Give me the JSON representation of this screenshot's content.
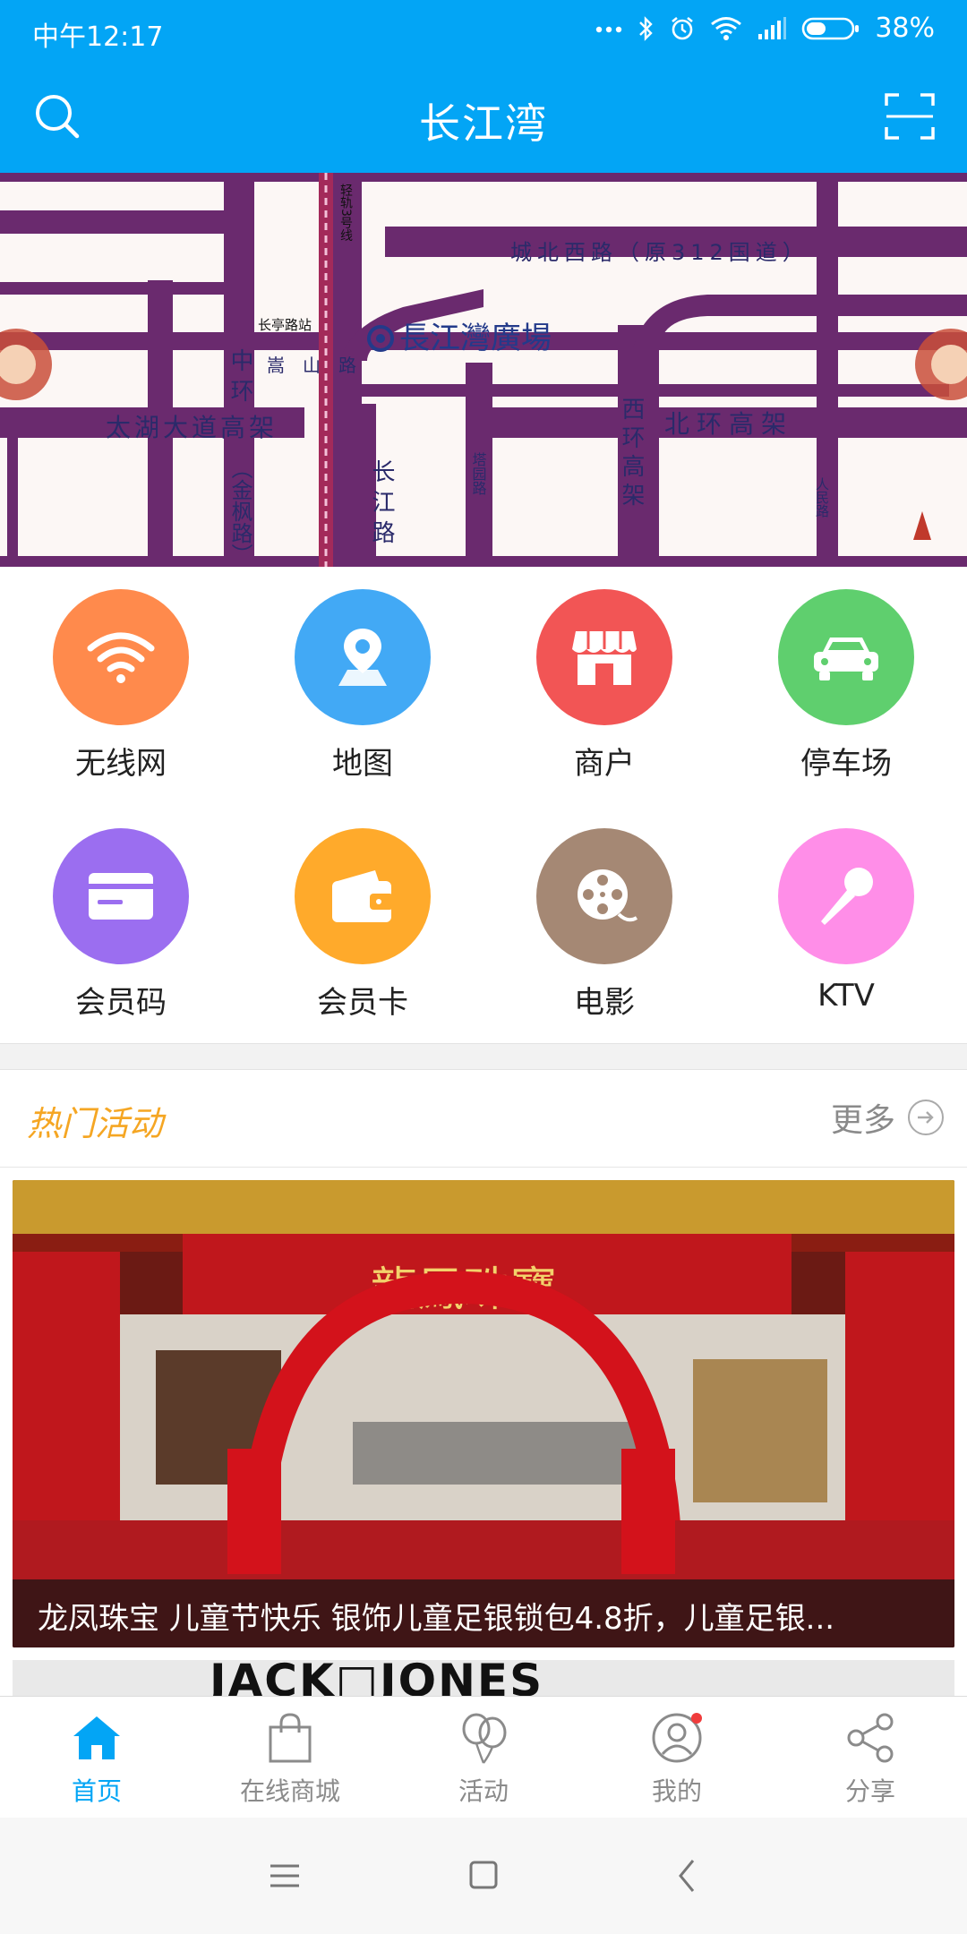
{
  "status_bar": {
    "time": "中午12:17",
    "battery": "38%",
    "icons": [
      "more-dots-icon",
      "bluetooth-icon",
      "alarm-icon",
      "wifi-icon",
      "signal-icon",
      "battery-icon"
    ]
  },
  "header": {
    "title": "长江湾",
    "left_icon": "search-icon",
    "right_icon": "scan-icon",
    "background": "#03a5f5"
  },
  "banner": {
    "type": "map",
    "labels": {
      "logo": "長江灣廣場",
      "road_north": "城北西路（原312国道）",
      "road_taihu": "太湖大道高架",
      "road_beihuan": "北环高架",
      "road_songshan": "嵩山路",
      "road_zhonghuan": "中环",
      "road_jinfeng": "（金枫路）",
      "road_changjiang": "长江路",
      "road_tayuan": "塔园路",
      "road_xihuan": "西环高架",
      "road_renmin": "人民路",
      "rail_line": "轻轨3号线",
      "station": "长亭路站"
    }
  },
  "quick_grid": [
    {
      "label": "无线网",
      "icon": "wifi-icon",
      "color": "#ff8a4c"
    },
    {
      "label": "地图",
      "icon": "map-pin-icon",
      "color": "#42a9f5"
    },
    {
      "label": "商户",
      "icon": "store-icon",
      "color": "#f25555"
    },
    {
      "label": "停车场",
      "icon": "car-icon",
      "color": "#5fcf6e"
    },
    {
      "label": "会员码",
      "icon": "member-code-icon",
      "color": "#9b6ef0"
    },
    {
      "label": "会员卡",
      "icon": "wallet-icon",
      "color": "#ffaa2b"
    },
    {
      "label": "电影",
      "icon": "film-reel-icon",
      "color": "#a58874"
    },
    {
      "label": "KTV",
      "icon": "microphone-icon",
      "color": "#ff8ee8"
    }
  ],
  "hot_activities": {
    "title": "热门活动",
    "more_label": "更多",
    "items": [
      {
        "caption": "龙凤珠宝 儿童节快乐 银饰儿童足银锁包4.8折，儿童足银...",
        "image_text": "龍鳳珠寶"
      },
      {
        "image_text": "JACK□JONES"
      }
    ]
  },
  "bottom_nav": [
    {
      "label": "首页",
      "icon": "home-icon",
      "active": true
    },
    {
      "label": "在线商城",
      "icon": "shopping-bag-icon",
      "active": false
    },
    {
      "label": "活动",
      "icon": "balloons-icon",
      "active": false
    },
    {
      "label": "我的",
      "icon": "profile-icon",
      "active": false
    },
    {
      "label": "分享",
      "icon": "share-icon",
      "active": false
    }
  ],
  "system_nav": [
    "menu-icon",
    "home-square-icon",
    "back-icon"
  ]
}
